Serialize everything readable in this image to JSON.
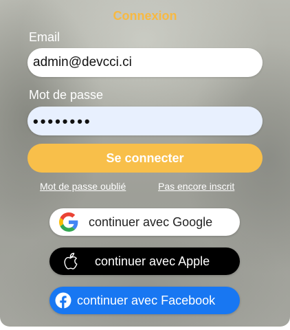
{
  "form": {
    "title": "Connexion",
    "email_label": "Email",
    "email_value": "admin@devcci.ci",
    "password_label": "Mot de passe",
    "password_value": "••••••••",
    "submit_label": "Se connecter",
    "forgot_link": "Mot de passe oublié",
    "register_link": "Pas encore inscrit"
  },
  "social": {
    "google_label": "continuer avec Google",
    "apple_label": "continuer avec Apple",
    "facebook_label": "continuer avec Facebook",
    "google_icon": "google-icon",
    "apple_icon": "apple-icon",
    "facebook_icon": "facebook-icon"
  },
  "colors": {
    "accent": "#f8bf4a",
    "title": "#f7b942",
    "facebook": "#1877f2"
  }
}
